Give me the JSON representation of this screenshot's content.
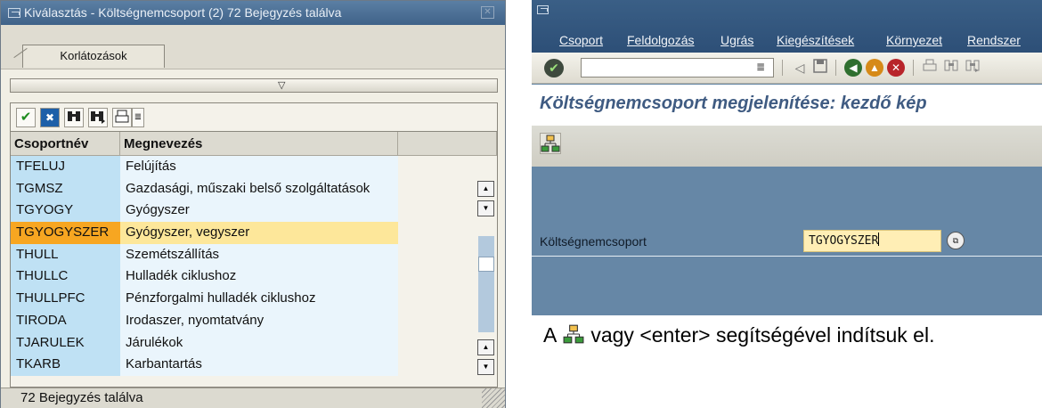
{
  "dialog": {
    "title": "Kiválasztás - Költségnemcsoport (2)   72 Bejegyzés találva",
    "close_icon": "close-icon",
    "tab_label": "Korlátozások",
    "columns": [
      "Csoportnév",
      "Megnevezés"
    ],
    "rows": [
      {
        "code": "TFELUJ",
        "name": "Felújítás"
      },
      {
        "code": "TGMSZ",
        "name": "Gazdasági, műszaki belső szolgáltatások"
      },
      {
        "code": "TGYOGY",
        "name": "Gyógyszer"
      },
      {
        "code": "TGYOGYSZER",
        "name": "Gyógyszer, vegyszer",
        "selected": true
      },
      {
        "code": "THULL",
        "name": "Szemétszállítás"
      },
      {
        "code": "THULLC",
        "name": "Hulladék ciklushoz"
      },
      {
        "code": "THULLPFC",
        "name": "Pénzforgalmi hulladék ciklushoz"
      },
      {
        "code": "TIRODA",
        "name": "Irodaszer, nyomtatvány"
      },
      {
        "code": "TJARULEK",
        "name": "Járulékok"
      },
      {
        "code": "TKARB",
        "name": "Karbantartás"
      }
    ],
    "status_text": "72 Bejegyzés találva",
    "selected_row_color": "#f7a621"
  },
  "sap_window": {
    "menu": [
      "Csoport",
      "Feldolgozás",
      "Ugrás",
      "Kiegészítések",
      "Környezet",
      "Rendszer"
    ],
    "page_title": "Költségnemcsoport megjelenítése: kezdő kép",
    "field_label": "Költségnemcsoport",
    "field_value": "TGYOGYSZER",
    "accent_color": "#3f5b82"
  },
  "instruction": {
    "before": "A",
    "after": "vagy <enter> segítségével indítsuk el."
  }
}
